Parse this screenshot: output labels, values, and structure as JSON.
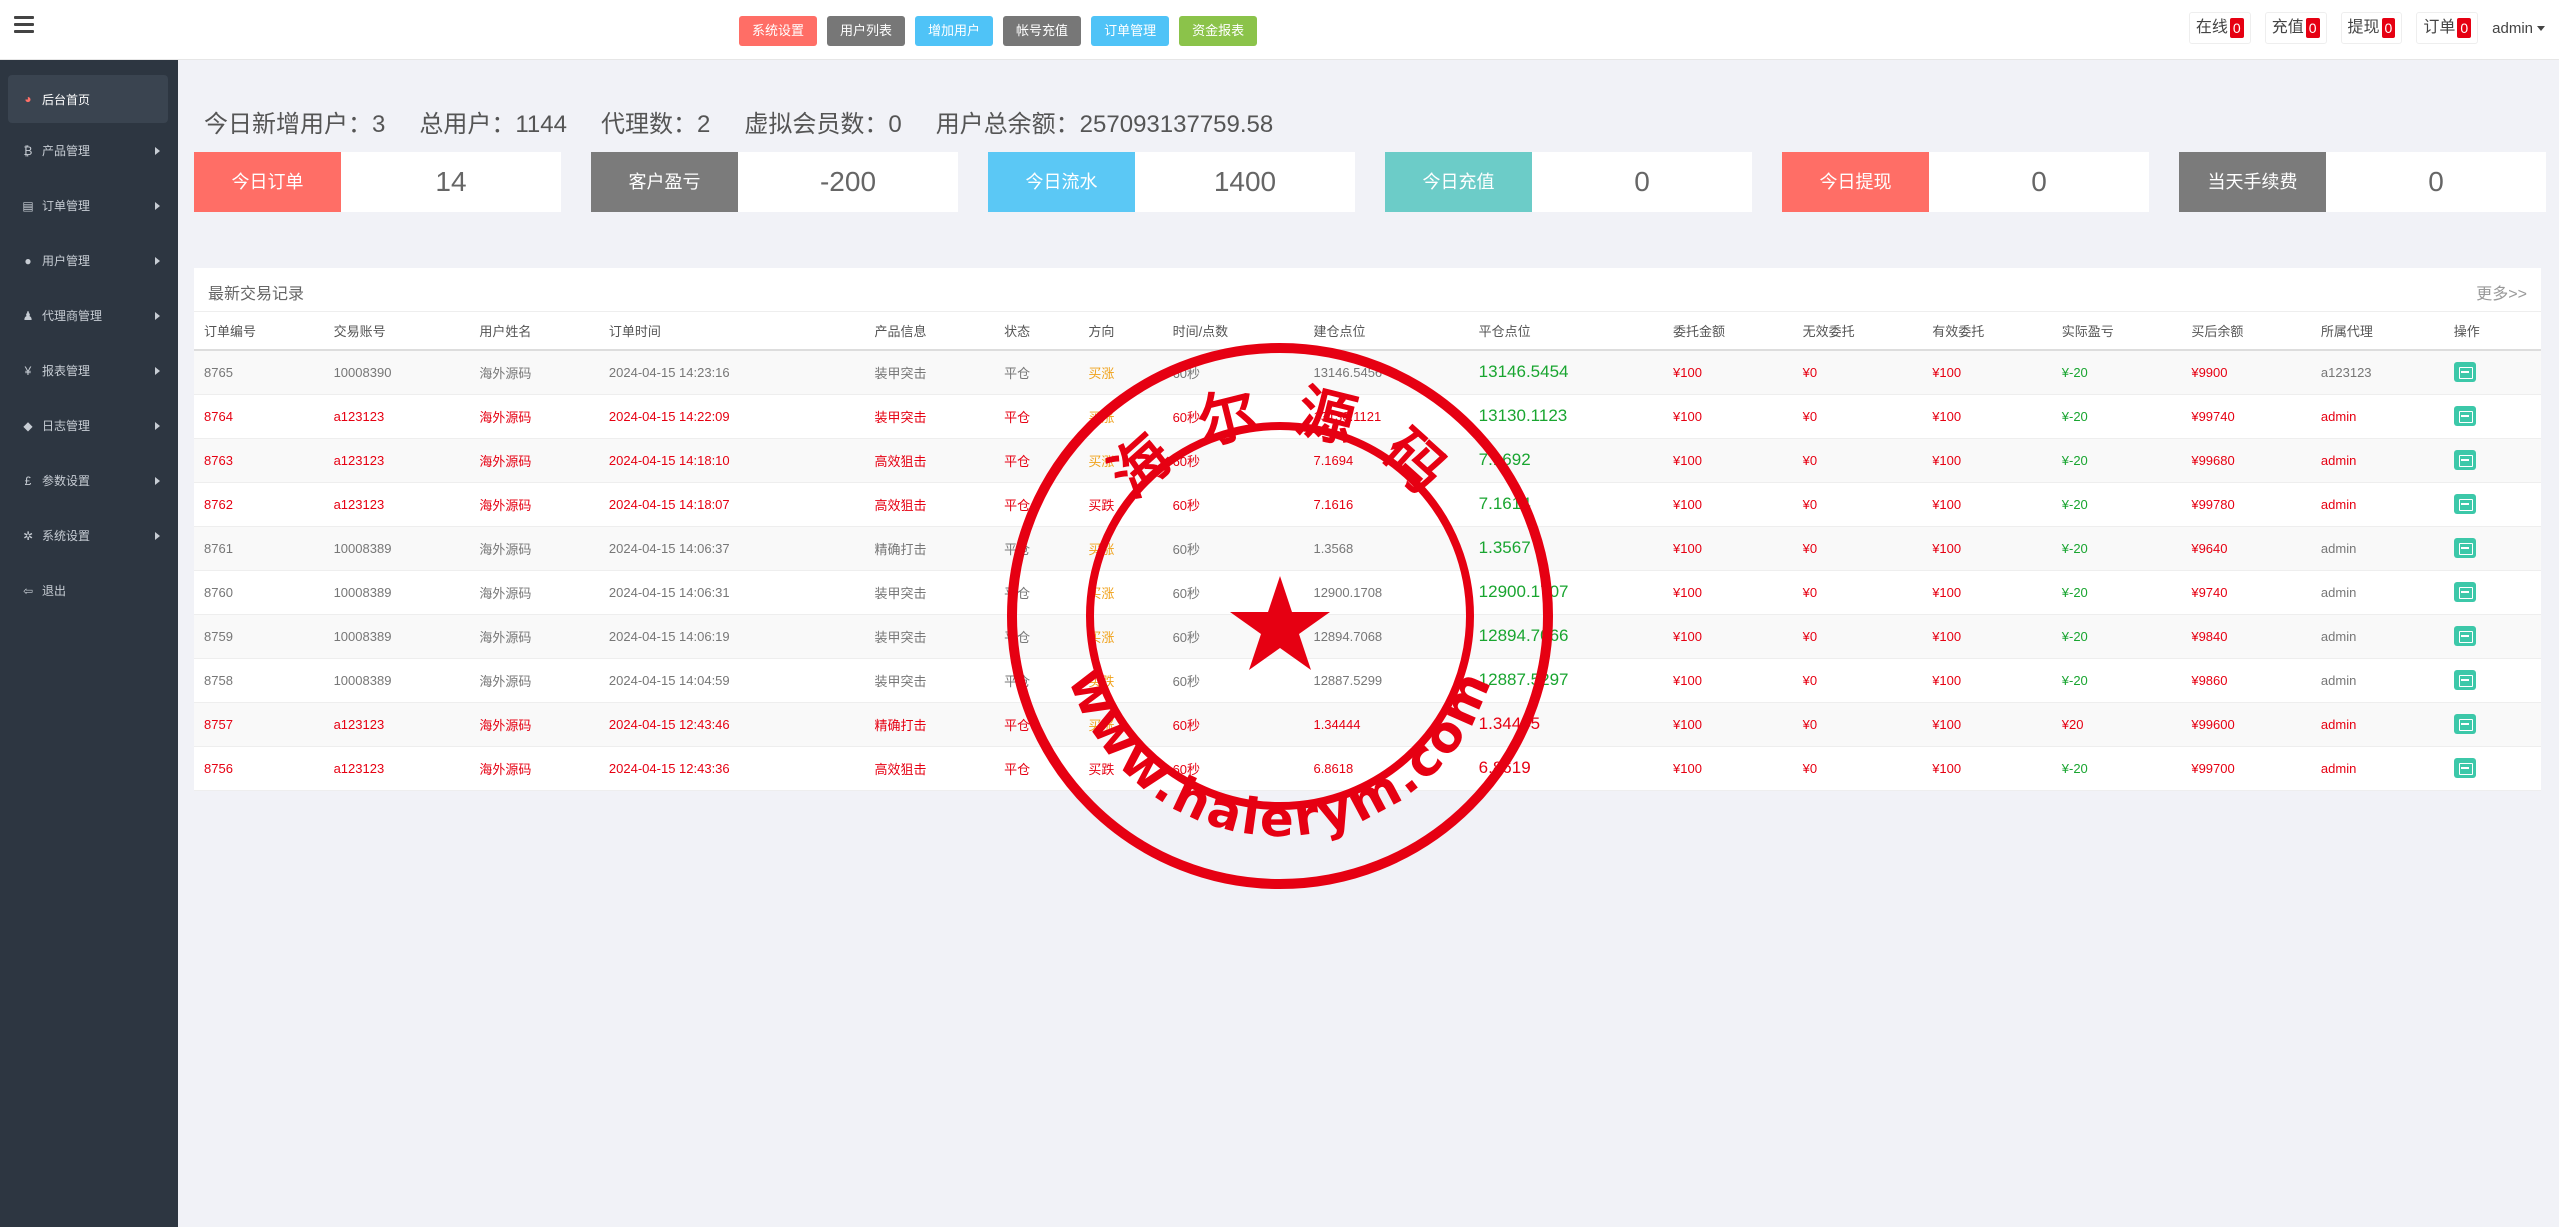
{
  "topbar": {
    "buttons": [
      {
        "label": "系统设置",
        "color": "#ff6e66"
      },
      {
        "label": "用户列表",
        "color": "#777777"
      },
      {
        "label": "增加用户",
        "color": "#4fc3f7"
      },
      {
        "label": "帐号充值",
        "color": "#777777"
      },
      {
        "label": "订单管理",
        "color": "#4fc3f7"
      },
      {
        "label": "资金报表",
        "color": "#8bc34a"
      }
    ],
    "stats": [
      {
        "label": "在线",
        "count": "0"
      },
      {
        "label": "充值",
        "count": "0"
      },
      {
        "label": "提现",
        "count": "0"
      },
      {
        "label": "订单",
        "count": "0"
      }
    ],
    "user": "admin"
  },
  "sidebar": {
    "items": [
      {
        "label": "后台首页",
        "icon": "dashboard-icon",
        "glyph": "◕",
        "active": true
      },
      {
        "label": "产品管理",
        "icon": "bitcoin-icon",
        "glyph": "₿"
      },
      {
        "label": "订单管理",
        "icon": "orders-icon",
        "glyph": "▤"
      },
      {
        "label": "用户管理",
        "icon": "user-icon",
        "glyph": "●"
      },
      {
        "label": "代理商管理",
        "icon": "agents-icon",
        "glyph": "♟"
      },
      {
        "label": "报表管理",
        "icon": "yen-icon",
        "glyph": "¥"
      },
      {
        "label": "日志管理",
        "icon": "tag-icon",
        "glyph": "◆"
      },
      {
        "label": "参数设置",
        "icon": "pound-icon",
        "glyph": "£"
      },
      {
        "label": "系统设置",
        "icon": "gears-icon",
        "glyph": "✲"
      },
      {
        "label": "退出",
        "icon": "signout-icon",
        "glyph": "⇦"
      }
    ]
  },
  "summary": {
    "new_users": "今日新增用户：3",
    "total_users": "总用户：1144",
    "agents": "代理数：2",
    "virtual_members": "虚拟会员数：0",
    "total_balance": "用户总余额：257093137759.58"
  },
  "cards": [
    {
      "label": "今日订单",
      "value": "14",
      "color": "#ff6e66"
    },
    {
      "label": "客户盈亏",
      "value": "-200",
      "color": "#7b7b7b"
    },
    {
      "label": "今日流水",
      "value": "1400",
      "color": "#5bc8f5"
    },
    {
      "label": "今日充值",
      "value": "0",
      "color": "#6cccc8"
    },
    {
      "label": "今日提现",
      "value": "0",
      "color": "#ff6e66"
    },
    {
      "label": "当天手续费",
      "value": "0",
      "color": "#7b7b7b"
    }
  ],
  "table": {
    "title": "最新交易记录",
    "more": "更多>>",
    "headers": [
      "订单编号",
      "交易账号",
      "用户姓名",
      "订单时间",
      "产品信息",
      "状态",
      "方向",
      "时间/点数",
      "建仓点位",
      "平仓点位",
      "委托金额",
      "无效委托",
      "有效委托",
      "实际盈亏",
      "买后余额",
      "所属代理",
      "操作"
    ],
    "rows": [
      {
        "id": "8765",
        "account": "10008390",
        "name": "海外源码",
        "time": "2024-04-15 14:23:16",
        "product": "装甲突击",
        "status": "平仓",
        "direction": "买涨",
        "duration": "60秒",
        "open": "13146.5456",
        "close": "13146.5454",
        "amount": "¥100",
        "invalid": "¥0",
        "valid": "¥100",
        "pnl": "¥-20",
        "balance": "¥9900",
        "agent": "a123123",
        "red": false
      },
      {
        "id": "8764",
        "account": "a123123",
        "name": "海外源码",
        "time": "2024-04-15 14:22:09",
        "product": "装甲突击",
        "status": "平仓",
        "direction": "买涨",
        "duration": "60秒",
        "open": "13130.1121",
        "close": "13130.1123",
        "amount": "¥100",
        "invalid": "¥0",
        "valid": "¥100",
        "pnl": "¥-20",
        "balance": "¥99740",
        "agent": "admin",
        "red": true
      },
      {
        "id": "8763",
        "account": "a123123",
        "name": "海外源码",
        "time": "2024-04-15 14:18:10",
        "product": "高效狙击",
        "status": "平仓",
        "direction": "买涨",
        "duration": "60秒",
        "open": "7.1694",
        "close": "7.1692",
        "amount": "¥100",
        "invalid": "¥0",
        "valid": "¥100",
        "pnl": "¥-20",
        "balance": "¥99680",
        "agent": "admin",
        "red": true
      },
      {
        "id": "8762",
        "account": "a123123",
        "name": "海外源码",
        "time": "2024-04-15 14:18:07",
        "product": "高效狙击",
        "status": "平仓",
        "direction": "买跌",
        "duration": "60秒",
        "open": "7.1616",
        "close": "7.1614",
        "amount": "¥100",
        "invalid": "¥0",
        "valid": "¥100",
        "pnl": "¥-20",
        "balance": "¥99780",
        "agent": "admin",
        "red": true
      },
      {
        "id": "8761",
        "account": "10008389",
        "name": "海外源码",
        "time": "2024-04-15 14:06:37",
        "product": "精确打击",
        "status": "平仓",
        "direction": "买涨",
        "duration": "60秒",
        "open": "1.3568",
        "close": "1.3567",
        "amount": "¥100",
        "invalid": "¥0",
        "valid": "¥100",
        "pnl": "¥-20",
        "balance": "¥9640",
        "agent": "admin",
        "red": false
      },
      {
        "id": "8760",
        "account": "10008389",
        "name": "海外源码",
        "time": "2024-04-15 14:06:31",
        "product": "装甲突击",
        "status": "平仓",
        "direction": "买涨",
        "duration": "60秒",
        "open": "12900.1708",
        "close": "12900.1707",
        "amount": "¥100",
        "invalid": "¥0",
        "valid": "¥100",
        "pnl": "¥-20",
        "balance": "¥9740",
        "agent": "admin",
        "red": false
      },
      {
        "id": "8759",
        "account": "10008389",
        "name": "海外源码",
        "time": "2024-04-15 14:06:19",
        "product": "装甲突击",
        "status": "平仓",
        "direction": "买涨",
        "duration": "60秒",
        "open": "12894.7068",
        "close": "12894.7066",
        "amount": "¥100",
        "invalid": "¥0",
        "valid": "¥100",
        "pnl": "¥-20",
        "balance": "¥9840",
        "agent": "admin",
        "red": false
      },
      {
        "id": "8758",
        "account": "10008389",
        "name": "海外源码",
        "time": "2024-04-15 14:04:59",
        "product": "装甲突击",
        "status": "平仓",
        "direction": "买跌",
        "duration": "60秒",
        "open": "12887.5299",
        "close": "12887.5297",
        "amount": "¥100",
        "invalid": "¥0",
        "valid": "¥100",
        "pnl": "¥-20",
        "balance": "¥9860",
        "agent": "admin",
        "red": false
      },
      {
        "id": "8757",
        "account": "a123123",
        "name": "海外源码",
        "time": "2024-04-15 12:43:46",
        "product": "精确打击",
        "status": "平仓",
        "direction": "买涨",
        "duration": "60秒",
        "open": "1.34444",
        "close": "1.34445",
        "amount": "¥100",
        "invalid": "¥0",
        "valid": "¥100",
        "pnl": "¥20",
        "balance": "¥99600",
        "agent": "admin",
        "red": true
      },
      {
        "id": "8756",
        "account": "a123123",
        "name": "海外源码",
        "time": "2024-04-15 12:43:36",
        "product": "高效狙击",
        "status": "平仓",
        "direction": "买跌",
        "duration": "60秒",
        "open": "6.8618",
        "close": "6.8619",
        "amount": "¥100",
        "invalid": "¥0",
        "valid": "¥100",
        "pnl": "¥-20",
        "balance": "¥99700",
        "agent": "admin",
        "red": true
      }
    ]
  },
  "watermark": {
    "top_text": "海 尔 源 码",
    "bottom_text": "www.haierym.com",
    "color": "#e60012"
  }
}
